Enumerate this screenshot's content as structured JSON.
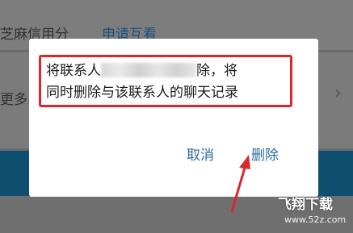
{
  "background": {
    "row1_label": "芝麻信用分",
    "row1_link": "申请互看",
    "row2_label": "更多",
    "row2_chevron": "›"
  },
  "dialog": {
    "message_line1_start": "将联系人",
    "message_line1_end": "除，将",
    "message_line2": "同时删除与该联系人的聊天记录",
    "cancel_label": "取消",
    "delete_label": "删除"
  },
  "watermark": {
    "text": "飞翔下载",
    "url": "www.52z.com"
  },
  "colors": {
    "highlight_border": "#d9272e",
    "button_text": "#2e6da4",
    "arrow": "#d9272e"
  }
}
